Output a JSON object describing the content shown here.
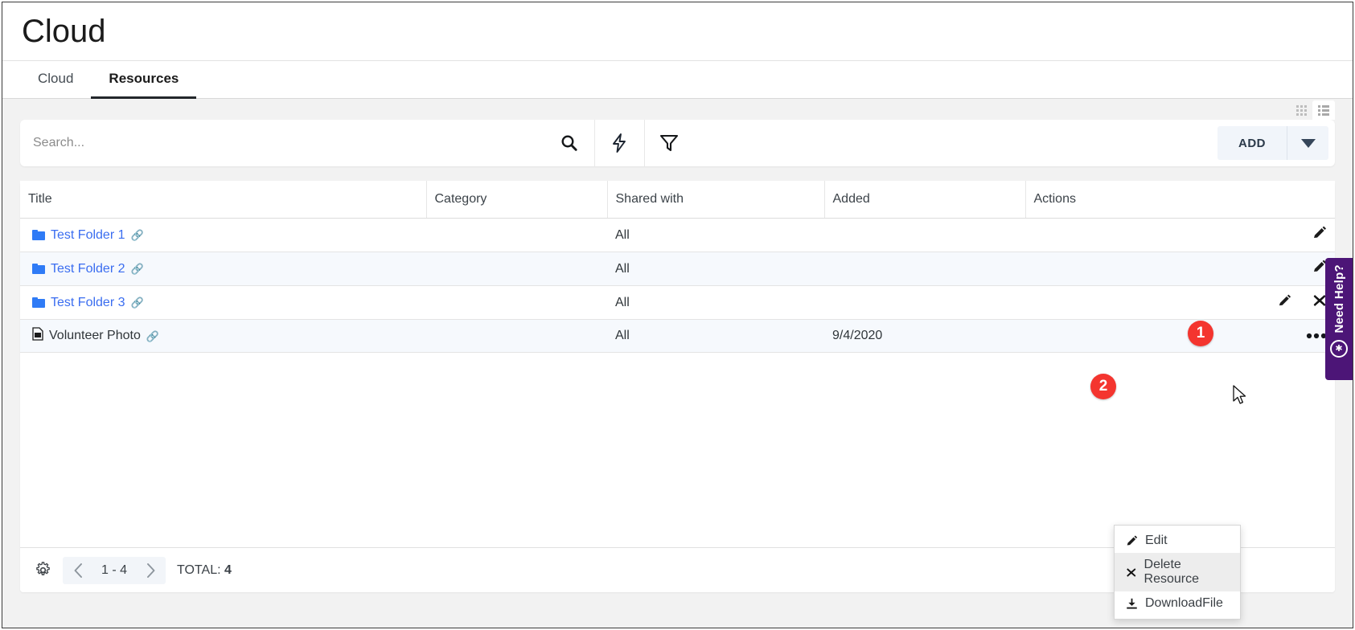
{
  "header": {
    "title": "Cloud"
  },
  "tabs": [
    {
      "label": "Cloud",
      "active": false
    },
    {
      "label": "Resources",
      "active": true
    }
  ],
  "view_toggle": {
    "grid_icon": "grid-view-icon",
    "list_icon": "list-view-icon",
    "active": "list"
  },
  "toolbar": {
    "search_value": "",
    "search_placeholder": "Search...",
    "search_icon": "search-icon",
    "quick_action_icon": "lightning-bolt-icon",
    "filter_icon": "filter-funnel-icon",
    "add_label": "ADD",
    "add_caret_icon": "chevron-down-icon"
  },
  "table": {
    "columns": [
      "Title",
      "Category",
      "Shared with",
      "Added",
      "Actions"
    ],
    "rows": [
      {
        "title": "Test Folder 1",
        "type_icon": "folder-icon",
        "link_icon": "chain-link-icon",
        "is_link": true,
        "category": "",
        "shared_with": "All",
        "added": "",
        "actions": [
          "edit-pencil-icon"
        ]
      },
      {
        "title": "Test Folder 2",
        "type_icon": "folder-icon",
        "link_icon": "chain-link-icon",
        "is_link": true,
        "category": "",
        "shared_with": "All",
        "added": "",
        "actions": [
          "edit-pencil-icon"
        ]
      },
      {
        "title": "Test Folder 3",
        "type_icon": "folder-icon",
        "link_icon": "chain-link-icon",
        "is_link": true,
        "category": "",
        "shared_with": "All",
        "added": "",
        "actions": [
          "edit-pencil-icon",
          "delete-x-icon"
        ]
      },
      {
        "title": "Volunteer Photo",
        "type_icon": "file-image-icon",
        "link_icon": "chain-link-icon",
        "is_link": false,
        "category": "",
        "shared_with": "All",
        "added": "9/4/2020",
        "actions": [
          "more-ellipsis-icon"
        ]
      }
    ]
  },
  "context_menu": {
    "items": [
      {
        "label": "Edit",
        "icon": "edit-pencil-icon",
        "hover": false
      },
      {
        "label": "Delete Resource",
        "icon": "delete-x-icon",
        "hover": true
      },
      {
        "label": "DownloadFile",
        "icon": "download-icon",
        "hover": false
      }
    ]
  },
  "footer": {
    "settings_icon": "gear-icon",
    "prev_icon": "chevron-left-icon",
    "next_icon": "chevron-right-icon",
    "page_range": "1 - 4",
    "total_label": "TOTAL:",
    "total_value": "4"
  },
  "help_tab": {
    "label": "Need Help?",
    "icon": "life-ring-icon",
    "color": "#4c1577"
  },
  "steps": [
    {
      "number": "1"
    },
    {
      "number": "2"
    }
  ],
  "colors": {
    "accent_link": "#3a6df0",
    "step_marker": "#f4352f",
    "help_purple": "#4c1577"
  }
}
